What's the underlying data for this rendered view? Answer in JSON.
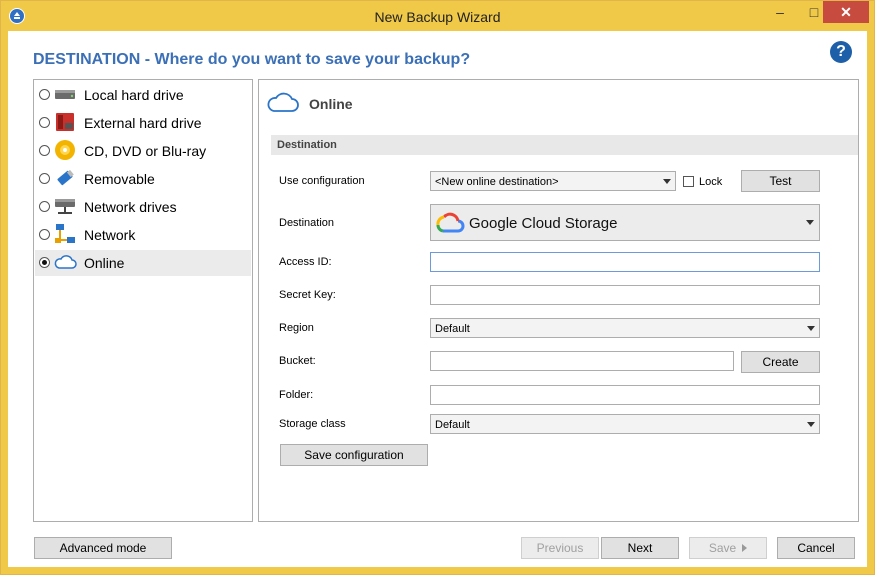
{
  "window": {
    "title": "New Backup Wizard",
    "min_label": "–",
    "max_label": "□",
    "close_label": "✕"
  },
  "heading": "DESTINATION - Where do you want to save your backup?",
  "help_label": "?",
  "destinations": [
    {
      "label": "Local hard drive",
      "icon": "hard-drive-icon",
      "selected": false
    },
    {
      "label": "External hard drive",
      "icon": "external-drive-icon",
      "selected": false
    },
    {
      "label": "CD, DVD or Blu-ray",
      "icon": "disc-icon",
      "selected": false
    },
    {
      "label": "Removable",
      "icon": "usb-drive-icon",
      "selected": false
    },
    {
      "label": "Network drives",
      "icon": "network-drive-icon",
      "selected": false
    },
    {
      "label": "Network",
      "icon": "network-icon",
      "selected": false
    },
    {
      "label": "Online",
      "icon": "cloud-icon",
      "selected": true
    }
  ],
  "panel": {
    "title": "Online",
    "section": "Destination",
    "use_config_label": "Use configuration",
    "use_config_value": "<New online destination>",
    "lock_label": "Lock",
    "test_label": "Test",
    "destination_label": "Destination",
    "destination_value": "Google Cloud Storage",
    "access_id_label": "Access ID:",
    "access_id_value": "",
    "secret_key_label": "Secret Key:",
    "secret_key_value": "",
    "region_label": "Region",
    "region_value": "Default",
    "bucket_label": "Bucket:",
    "bucket_value": "",
    "create_label": "Create",
    "folder_label": "Folder:",
    "folder_value": "",
    "storage_class_label": "Storage class",
    "storage_class_value": "Default",
    "save_config_label": "Save configuration"
  },
  "footer": {
    "advanced_label": "Advanced mode",
    "previous_label": "Previous",
    "next_label": "Next",
    "save_label": "Save",
    "cancel_label": "Cancel"
  },
  "colors": {
    "titlebar": "#f0c948",
    "heading": "#3b6fb6",
    "close": "#c74b3f",
    "help": "#1d5fa8"
  }
}
